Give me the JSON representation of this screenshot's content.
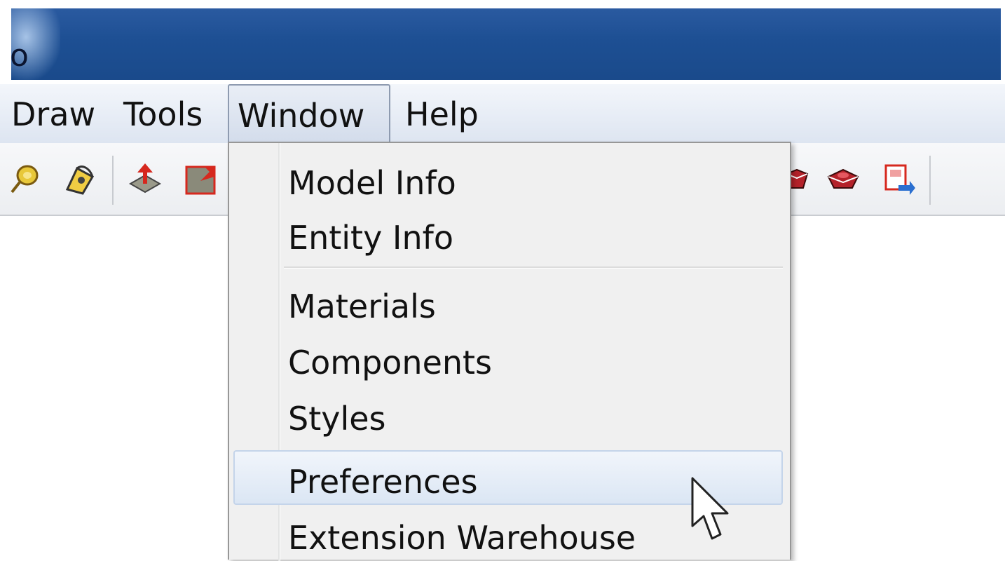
{
  "window": {
    "title_fragment": "o"
  },
  "menubar": {
    "items": [
      {
        "label": "Draw"
      },
      {
        "label": "Tools"
      },
      {
        "label": "Window",
        "open": true
      },
      {
        "label": "Help"
      }
    ]
  },
  "toolbar": {
    "left_icons": [
      "tape-measure-icon",
      "paint-bucket-icon",
      "push-pull-icon",
      "scale-icon"
    ],
    "right_icons": [
      "warehouse-icon",
      "extension-warehouse-icon",
      "send-to-layout-icon"
    ]
  },
  "window_menu": {
    "items": [
      {
        "label": "Model Info"
      },
      {
        "label": "Entity Info"
      },
      {
        "label": "Materials"
      },
      {
        "label": "Components"
      },
      {
        "label": "Styles"
      },
      {
        "label": "Preferences",
        "highlighted": true
      },
      {
        "label": "Extension Warehouse"
      }
    ]
  },
  "colors": {
    "title_bar": "#1d4f93",
    "menu_highlight": "#dbe6f4",
    "menu_background": "#f0f0f0"
  }
}
